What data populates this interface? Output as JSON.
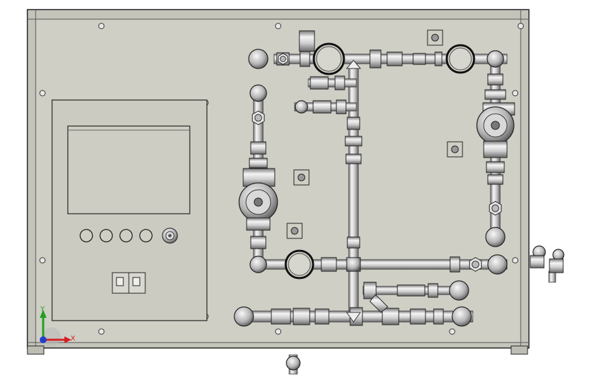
{
  "axis_triad": {
    "x_label": "X",
    "y_label": "Y",
    "x_color": "#d42020",
    "y_color": "#1fa11f",
    "origin_color": "#1f3fcf"
  },
  "colors": {
    "background": "#ffffff",
    "panel": "#cfcfc6",
    "panel_inner": "#c9c9bf",
    "outline": "#2a2a2a",
    "metal_light": "#f2f2f2",
    "metal_mid": "#a9a9a9",
    "metal_dark": "#5a5a5a"
  },
  "control_box": {
    "button_count": 4,
    "breaker_poles": 2
  }
}
